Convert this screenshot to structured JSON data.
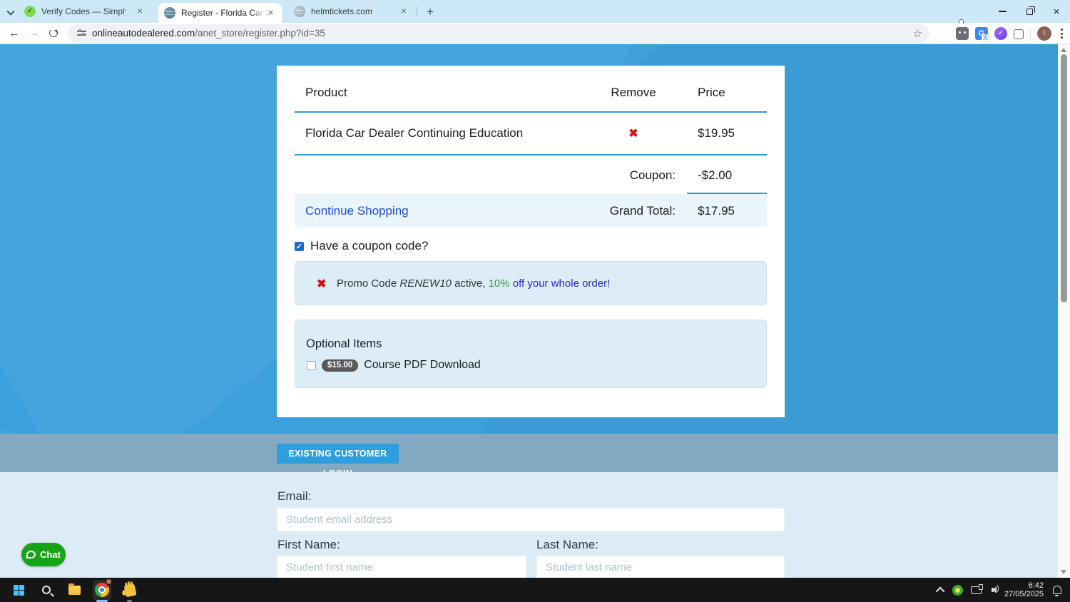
{
  "browser": {
    "tabs": [
      {
        "title": "Verify Codes — SimplyCodes"
      },
      {
        "title": "Register - Florida Car Dealer Co"
      },
      {
        "title": "helmtickets.com"
      }
    ],
    "url_domain": "onlineautodealered.com",
    "url_path": "/anet_store/register.php?id=35",
    "profile_initial": "I"
  },
  "icons": {
    "back": "←",
    "forward": "→",
    "star": "☆",
    "close_tab": "×",
    "close_window": "×",
    "plus": "+",
    "check": "✓",
    "remove_x": "✖",
    "simplycodes_check": "✓"
  },
  "cart": {
    "headers": {
      "product": "Product",
      "remove": "Remove",
      "price": "Price"
    },
    "item": {
      "name": "Florida Car Dealer Continuing Education",
      "price": "$19.95"
    },
    "coupon_label": "Coupon:",
    "coupon_value": "-$2.00",
    "continue_shopping": "Continue Shopping",
    "grand_total_label": "Grand Total:",
    "grand_total_value": "$17.95"
  },
  "coupon": {
    "checkbox_label": "Have a coupon code?",
    "promo_prefix": "Promo Code ",
    "promo_code": "RENEW10",
    "promo_mid": " active, ",
    "promo_percent": "10%",
    "promo_suffix": " off your whole order!"
  },
  "optional": {
    "heading": "Optional Items",
    "badge": "$15.00",
    "label": "Course PDF Download"
  },
  "login": {
    "button": "EXISTING CUSTOMER LOGIN"
  },
  "form": {
    "email_label": "Email:",
    "email_placeholder": "Student email address",
    "first_label": "First Name:",
    "first_placeholder": "Student first name",
    "last_label": "Last Name:",
    "last_placeholder": "Student last name"
  },
  "chat": {
    "label": "Chat"
  },
  "taskbar": {
    "time": "6:42",
    "date": "27/05/2025"
  },
  "colors": {
    "page_bg": "#3ca0dc",
    "accent_blue": "#2f9ede",
    "table_border": "#2e9bd6",
    "link_blue": "#1d4fd7",
    "promo_green": "#2e9e3c",
    "promo_blue": "#2a2ad4",
    "error_red": "#d11212",
    "chat_green": "#17a317"
  }
}
